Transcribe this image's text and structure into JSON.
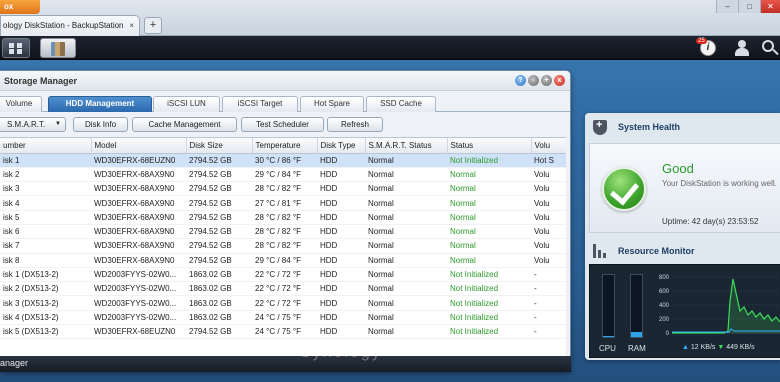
{
  "browser": {
    "app_label": "ox",
    "tab_title": "ology DiskStation - BackupStation",
    "tab_close": "×",
    "new_tab": "+",
    "controls": [
      "–",
      "□",
      "✕"
    ]
  },
  "taskbar": {
    "notification_count": "25",
    "notification_icon_glyph": "i"
  },
  "storage_manager": {
    "title": "Storage Manager",
    "window_buttons": {
      "help": "?",
      "minimize": "-",
      "maximize": "+",
      "close": "x"
    },
    "tabs": [
      {
        "label": "Volume",
        "active": false
      },
      {
        "label": "HDD Management",
        "active": true
      },
      {
        "label": "iSCSI LUN",
        "active": false
      },
      {
        "label": "iSCSI Target",
        "active": false
      },
      {
        "label": "Hot Spare",
        "active": false
      },
      {
        "label": "SSD Cache",
        "active": false
      }
    ],
    "toolbar": {
      "smart_label": "S.M.A.R.T.",
      "smart_caret": "▼",
      "disk_info_label": "Disk Info",
      "cache_mgmt_label": "Cache Management",
      "test_scheduler_label": "Test Scheduler",
      "refresh_label": "Refresh"
    },
    "columns": [
      "umber",
      "Model",
      "Disk Size",
      "Temperature",
      "Disk Type",
      "S.M.A.R.T. Status",
      "Status",
      "Volu"
    ],
    "rows": [
      {
        "number": "isk 1",
        "model": "WD30EFRX-68EUZN0",
        "size": "2794.52 GB",
        "temp": "30 °C / 86 °F",
        "type": "HDD",
        "smart": "Normal",
        "status": "Not Initialized",
        "volume": "Hot S",
        "selected": true
      },
      {
        "number": "isk 2",
        "model": "WD30EFRX-68AX9N0",
        "size": "2794.52 GB",
        "temp": "29 °C / 84 °F",
        "type": "HDD",
        "smart": "Normal",
        "status": "Normal",
        "volume": "Volu"
      },
      {
        "number": "isk 3",
        "model": "WD30EFRX-68AX9N0",
        "size": "2794.52 GB",
        "temp": "28 °C / 82 °F",
        "type": "HDD",
        "smart": "Normal",
        "status": "Normal",
        "volume": "Volu"
      },
      {
        "number": "isk 4",
        "model": "WD30EFRX-68AX9N0",
        "size": "2794.52 GB",
        "temp": "27 °C / 81 °F",
        "type": "HDD",
        "smart": "Normal",
        "status": "Normal",
        "volume": "Volu"
      },
      {
        "number": "isk 5",
        "model": "WD30EFRX-68AX9N0",
        "size": "2794.52 GB",
        "temp": "28 °C / 82 °F",
        "type": "HDD",
        "smart": "Normal",
        "status": "Normal",
        "volume": "Volu"
      },
      {
        "number": "isk 6",
        "model": "WD30EFRX-68AX9N0",
        "size": "2794.52 GB",
        "temp": "28 °C / 82 °F",
        "type": "HDD",
        "smart": "Normal",
        "status": "Normal",
        "volume": "Volu"
      },
      {
        "number": "isk 7",
        "model": "WD30EFRX-68AX9N0",
        "size": "2794.52 GB",
        "temp": "28 °C / 82 °F",
        "type": "HDD",
        "smart": "Normal",
        "status": "Normal",
        "volume": "Volu"
      },
      {
        "number": "isk 8",
        "model": "WD30EFRX-68AX9N0",
        "size": "2794.52 GB",
        "temp": "29 °C / 84 °F",
        "type": "HDD",
        "smart": "Normal",
        "status": "Normal",
        "volume": "Volu"
      },
      {
        "number": "isk 1 (DX513-2)",
        "model": "WD2003FYYS-02W0...",
        "size": "1863.02 GB",
        "temp": "22 °C / 72 °F",
        "type": "HDD",
        "smart": "Normal",
        "status": "Not Initialized",
        "volume": "-"
      },
      {
        "number": "isk 2 (DX513-2)",
        "model": "WD2003FYYS-02W0...",
        "size": "1863.02 GB",
        "temp": "22 °C / 72 °F",
        "type": "HDD",
        "smart": "Normal",
        "status": "Not Initialized",
        "volume": "-"
      },
      {
        "number": "isk 3 (DX513-2)",
        "model": "WD2003FYYS-02W0...",
        "size": "1863.02 GB",
        "temp": "22 °C / 72 °F",
        "type": "HDD",
        "smart": "Normal",
        "status": "Not Initialized",
        "volume": "-"
      },
      {
        "number": "isk 4 (DX513-2)",
        "model": "WD2003FYYS-02W0...",
        "size": "1863.02 GB",
        "temp": "24 °C / 75 °F",
        "type": "HDD",
        "smart": "Normal",
        "status": "Not Initialized",
        "volume": "-"
      },
      {
        "number": "isk 5 (DX513-2)",
        "model": "WD30EFRX-68EUZN0",
        "size": "2794.52 GB",
        "temp": "24 °C / 75 °F",
        "type": "HDD",
        "smart": "Normal",
        "status": "Not Initialized",
        "volume": "-"
      }
    ],
    "footer_label": "anager"
  },
  "system_health": {
    "title": "System Health",
    "status": "Good",
    "message": "Your DiskStation is working well.",
    "uptime": "Uptime: 42 day(s) 23:53:52"
  },
  "resource_monitor": {
    "title": "Resource Monitor",
    "cpu_label": "CPU",
    "ram_label": "RAM",
    "cpu_level": 0.02,
    "ram_level": 0.08,
    "chart_ticks": [
      "800",
      "600",
      "400",
      "200",
      "0"
    ],
    "upload": "12 KB/s",
    "download": "449 KB/s",
    "upload_arrow": "▲",
    "download_arrow": "▼"
  },
  "colors": {
    "accent": "#2c69ad",
    "ok_green": "#2d9a2d",
    "download_line": "#3ddc5a",
    "upload_line": "#33b3ff"
  }
}
